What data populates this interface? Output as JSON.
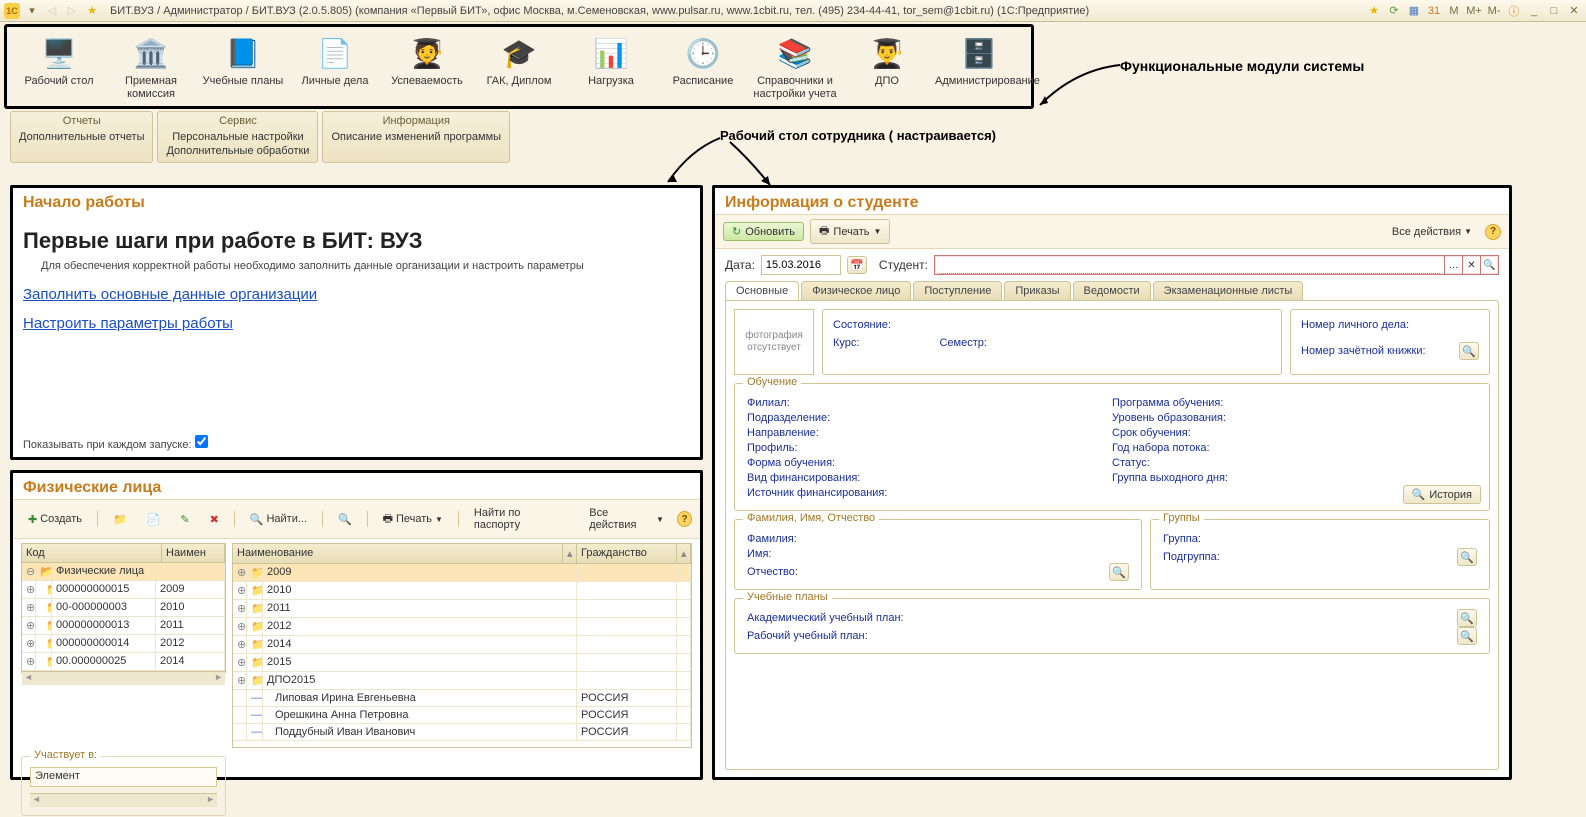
{
  "title": "БИТ.ВУЗ / Администратор / БИТ.ВУЗ (2.0.5.805) (компания «Первый БИТ», офис Москва, м.Семеновская, www.pulsar.ru, www.1cbit.ru, тел. (495) 234-44-41, tor_sem@1cbit.ru)  (1С:Предприятие)",
  "annotation_modules": "Функциональные модули системы",
  "annotation_desktop": "Рабочий стол сотрудника ( настраивается)",
  "modules": [
    {
      "label": "Рабочий стол",
      "icon": "🖥️"
    },
    {
      "label": "Приемная комиссия",
      "icon": "🏛️"
    },
    {
      "label": "Учебные планы",
      "icon": "📘"
    },
    {
      "label": "Личные дела",
      "icon": "📄"
    },
    {
      "label": "Успеваемость",
      "icon": "🧑‍🎓"
    },
    {
      "label": "ГАК, Диплом",
      "icon": "🎓"
    },
    {
      "label": "Нагрузка",
      "icon": "📊"
    },
    {
      "label": "Расписание",
      "icon": "🕒"
    },
    {
      "label": "Справочники и настройки учета",
      "icon": "📚"
    },
    {
      "label": "ДПО",
      "icon": "👨‍🎓"
    },
    {
      "label": "Администрирование",
      "icon": "🗄️"
    }
  ],
  "svc": {
    "reports": {
      "head": "Отчеты",
      "items": [
        "Дополнительные отчеты"
      ]
    },
    "service": {
      "head": "Сервис",
      "items": [
        "Персональные настройки",
        "Дополнительные обработки"
      ]
    },
    "info": {
      "head": "Информация",
      "items": [
        "Описание изменений программы"
      ]
    }
  },
  "start": {
    "title": "Начало работы",
    "h": "Первые шаги при работе в БИТ: ВУЗ",
    "desc": "Для обеспечения корректной работы необходимо заполнить данные организации и настроить параметры",
    "link1": "Заполнить основные данные организации",
    "link2": "Настроить параметры работы",
    "show": "Показывать при каждом запуске:"
  },
  "persons": {
    "title": "Физические лица",
    "toolbar": {
      "create": "Создать",
      "find": "Найти...",
      "print": "Печать",
      "passport": "Найти по паспорту",
      "all": "Все действия"
    },
    "headers": {
      "code": "Код",
      "name": "Наимен",
      "name2": "Наименование",
      "citizen": "Гражданство"
    },
    "tree1_root": "Физические лица",
    "tree1": [
      {
        "code": "000000000015",
        "name": "2009"
      },
      {
        "code": "00-000000003",
        "name": "2010"
      },
      {
        "code": "000000000013",
        "name": "2011"
      },
      {
        "code": "000000000014",
        "name": "2012"
      },
      {
        "code": "00.000000025",
        "name": "2014"
      }
    ],
    "tree2": [
      {
        "label": "2009",
        "sel": true
      },
      {
        "label": "2010"
      },
      {
        "label": "2011"
      },
      {
        "label": "2012"
      },
      {
        "label": "2014"
      },
      {
        "label": "2015"
      },
      {
        "label": "ДПО2015"
      }
    ],
    "people": [
      {
        "name": "Липовая Ирина Евгеньевна",
        "c": "РОССИЯ"
      },
      {
        "name": "Орешкина Анна Петровна",
        "c": "РОССИЯ"
      },
      {
        "name": "Поддубный Иван Иванович",
        "c": "РОССИЯ"
      }
    ],
    "part": "Участвует в:",
    "elem": "Элемент"
  },
  "stud": {
    "title": "Информация о студенте",
    "refresh": "Обновить",
    "print": "Печать",
    "all": "Все действия",
    "date_label": "Дата:",
    "date": "15.03.2016",
    "student_label": "Студент:",
    "tabs": [
      "Основные",
      "Физическое лицо",
      "Поступление",
      "Приказы",
      "Ведомости",
      "Экзаменационные листы"
    ],
    "photo": "фотография отсутствует",
    "state": "Состояние:",
    "course": "Курс:",
    "sem": "Семестр:",
    "ld": "Номер личного дела:",
    "zk": "Номер зачётной книжки:",
    "edu": {
      "legend": "Обучение",
      "l": [
        "Филиал:",
        "Подразделение:",
        "Направление:",
        "Профиль:",
        "Форма обучения:",
        "Вид финансирования:",
        "Источник финансирования:"
      ],
      "r": [
        "Программа обучения:",
        "Уровень образования:",
        "Срок обучения:",
        "Год набора потока:",
        "Статус:",
        "Группа выходного дня:"
      ],
      "hist": "История"
    },
    "fio": {
      "legend": "Фамилия, Имя, Отчество",
      "f": "Фамилия:",
      "i": "Имя:",
      "o": "Отчество:"
    },
    "grp": {
      "legend": "Группы",
      "g": "Группа:",
      "p": "Подгруппа:"
    },
    "plans": {
      "legend": "Учебные планы",
      "a": "Академический учебный план:",
      "r": "Рабочий учебный план:"
    }
  }
}
